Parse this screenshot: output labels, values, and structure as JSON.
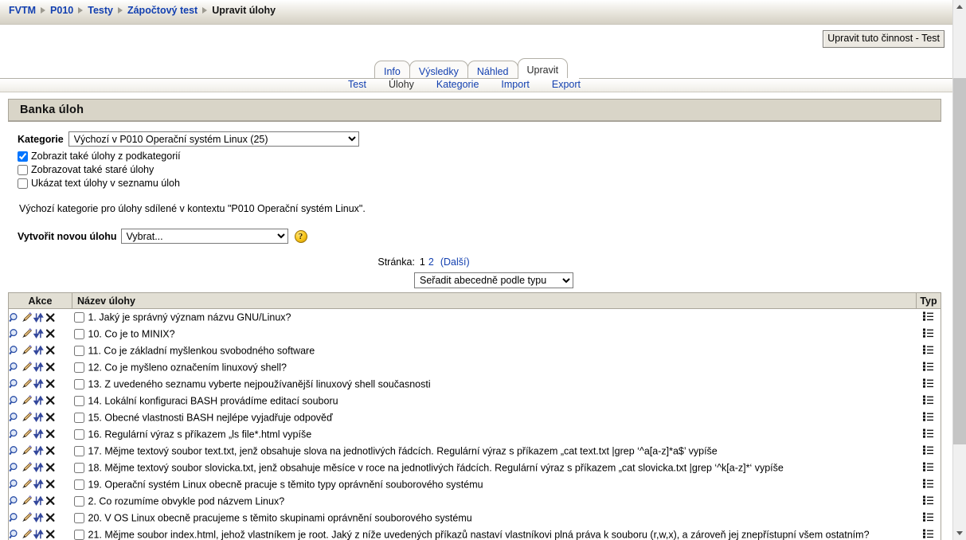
{
  "breadcrumb": {
    "items": [
      {
        "label": "FVTM",
        "link": true
      },
      {
        "label": "P010",
        "link": true
      },
      {
        "label": "Testy",
        "link": true
      },
      {
        "label": "Zápočtový test",
        "link": true
      },
      {
        "label": "Upravit úlohy",
        "link": false
      }
    ]
  },
  "edit_activity_button": "Upravit tuto činnost - Test",
  "tabs": [
    {
      "label": "Info",
      "active": false
    },
    {
      "label": "Výsledky",
      "active": false
    },
    {
      "label": "Náhled",
      "active": false
    },
    {
      "label": "Upravit",
      "active": true
    }
  ],
  "subtabs": [
    {
      "label": "Test",
      "active": false
    },
    {
      "label": "Úlohy",
      "active": true
    },
    {
      "label": "Kategorie",
      "active": false
    },
    {
      "label": "Import",
      "active": false
    },
    {
      "label": "Export",
      "active": false
    }
  ],
  "panel": {
    "title": "Banka úloh",
    "category_label": "Kategorie",
    "category_selected": "Výchozí v P010 Operační systém Linux (25)",
    "checkboxes": [
      {
        "label": "Zobrazit také úlohy z podkategorií",
        "checked": true
      },
      {
        "label": "Zobrazovat také staré úlohy",
        "checked": false
      },
      {
        "label": "Ukázat text úlohy v seznamu úloh",
        "checked": false
      }
    ],
    "category_description": "Výchozí kategorie pro úlohy sdílené v kontextu \"P010 Operační systém Linux\".",
    "create_label": "Vytvořit novou úlohu",
    "create_selected": "Vybrat...",
    "help_icon": "help-icon",
    "paging": {
      "label": "Stránka:",
      "current": "1",
      "pages": [
        "2"
      ],
      "next": "(Další)"
    },
    "sort_selected": "Seřadit abecedně podle typu"
  },
  "table": {
    "headers": {
      "actions": "Akce",
      "name": "Název úlohy",
      "type": "Typ"
    },
    "action_icons": [
      "preview-icon",
      "edit-icon",
      "move-icon",
      "delete-icon"
    ],
    "type_icon": "multichoice-icon",
    "rows": [
      {
        "name": "1. Jaký je správný význam názvu GNU/Linux?",
        "checked": false
      },
      {
        "name": "10. Co je to MINIX?",
        "checked": false
      },
      {
        "name": "11. Co je základní myšlenkou svobodného software",
        "checked": false
      },
      {
        "name": "12. Co je myšleno označením linuxový shell?",
        "checked": false
      },
      {
        "name": "13. Z uvedeného seznamu vyberte nejpoužívanější linuxový shell současnosti",
        "checked": false
      },
      {
        "name": "14. Lokální konfiguraci BASH provádíme editací souboru",
        "checked": false
      },
      {
        "name": "15. Obecné vlastnosti BASH nejlépe vyjadřuje odpověď",
        "checked": false
      },
      {
        "name": "16. Regulární výraz s příkazem „ls file*.html vypíše",
        "checked": false
      },
      {
        "name": "17. Mějme textový soubor text.txt, jenž obsahuje slova na jednotlivých řádcích. Regulární výraz s příkazem „cat text.txt |grep ‘^a[a-z]*a$’ vypíše",
        "checked": false
      },
      {
        "name": "18. Mějme textový soubor slovicka.txt, jenž obsahuje měsíce v roce na jednotlivých řádcích. Regulární výraz s příkazem „cat slovicka.txt |grep ‘^k[a-z]*‘ vypíše",
        "checked": false
      },
      {
        "name": "19. Operační systém Linux obecně pracuje s těmito typy oprávnění souborového systému",
        "checked": false
      },
      {
        "name": "2. Co rozumíme obvykle pod názvem Linux?",
        "checked": false
      },
      {
        "name": "20. V OS Linux obecně pracujeme s těmito skupinami oprávnění souborového systému",
        "checked": false
      },
      {
        "name": "21. Mějme soubor index.html, jehož vlastníkem je root. Jaký z níže uvedených příkazů nastaví vlastníkovi plná práva k souboru (r,w,x), a zároveň jej znepřístupní všem ostatním?",
        "checked": false
      }
    ]
  },
  "scrollbar": {
    "up_icon": "scroll-up-icon",
    "down_icon": "scroll-down-icon",
    "thumb": "scroll-thumb"
  },
  "colors": {
    "link": "#1340b0",
    "panel_header_bg": "#d9d5c8",
    "table_header_bg": "#e2dfd4",
    "breadcrumb_bg": "#dedacf"
  }
}
